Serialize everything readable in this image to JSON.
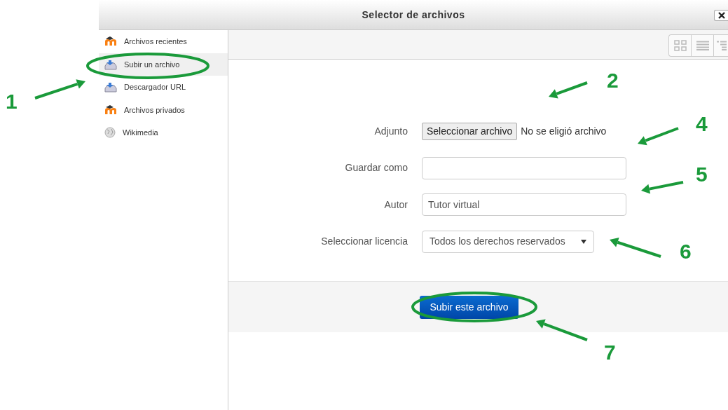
{
  "window": {
    "title": "Selector de archivos"
  },
  "sidebar": {
    "items": [
      {
        "label": "Archivos recientes",
        "kind": "moodle",
        "selected": false
      },
      {
        "label": "Subir un archivo",
        "kind": "upload",
        "selected": true
      },
      {
        "label": "Descargador URL",
        "kind": "upload",
        "selected": false
      },
      {
        "label": "Archivos privados",
        "kind": "moodle",
        "selected": false
      },
      {
        "label": "Wikimedia",
        "kind": "globe",
        "selected": false
      }
    ]
  },
  "form": {
    "fields": [
      {
        "label": "Adjunto",
        "kind": "file",
        "button": "Seleccionar archivo",
        "status": "No se eligió archivo"
      },
      {
        "label": "Guardar como",
        "kind": "text"
      },
      {
        "label": "Autor",
        "kind": "text",
        "value": "Tutor virtual"
      },
      {
        "label": "Seleccionar licencia",
        "kind": "select",
        "value": "Todos los derechos reservados"
      }
    ],
    "submit": "Subir este archivo"
  },
  "callouts": [
    {
      "label": "1"
    },
    {
      "label": "2"
    },
    {
      "label": "4"
    },
    {
      "label": "5"
    },
    {
      "label": "6"
    },
    {
      "label": "7"
    }
  ]
}
